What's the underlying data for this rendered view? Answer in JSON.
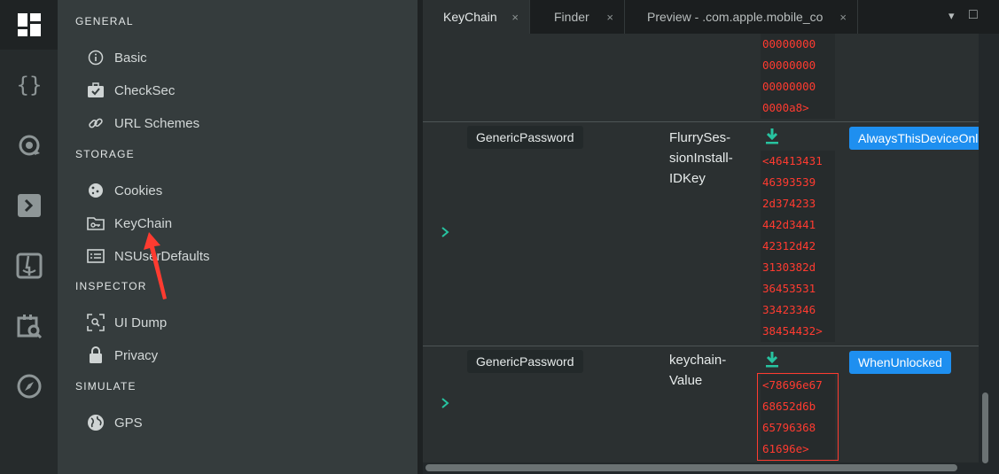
{
  "sidebar": {
    "sections": [
      {
        "title": "GENERAL",
        "items": [
          {
            "label": "Basic",
            "icon": "info-icon"
          },
          {
            "label": "CheckSec",
            "icon": "briefcase-check-icon"
          },
          {
            "label": "URL Schemes",
            "icon": "link-icon"
          }
        ]
      },
      {
        "title": "STORAGE",
        "items": [
          {
            "label": "Cookies",
            "icon": "cookie-icon"
          },
          {
            "label": "KeyChain",
            "icon": "folder-key-icon"
          },
          {
            "label": "NSUserDefaults",
            "icon": "list-box-icon"
          }
        ]
      },
      {
        "title": "INSPECTOR",
        "items": [
          {
            "label": "UI Dump",
            "icon": "scan-icon"
          },
          {
            "label": "Privacy",
            "icon": "lock-icon"
          }
        ]
      },
      {
        "title": "SIMULATE",
        "items": [
          {
            "label": "GPS",
            "icon": "globe-icon"
          }
        ]
      }
    ]
  },
  "tabs": [
    {
      "label": "KeyChain",
      "close": "×"
    },
    {
      "label": "Finder",
      "close": "×"
    },
    {
      "label": "Preview - .com.apple.mobile_co",
      "close": "×"
    }
  ],
  "window_controls": {
    "menu": "▾",
    "maximize": "□"
  },
  "rows": [
    {
      "hex": [
        "00000000",
        "00000000",
        "00000000",
        "0000a8>"
      ]
    },
    {
      "class": "GenericPassword",
      "key": [
        "FlurrySes-",
        "sionInstall-",
        "IDKey"
      ],
      "hex": [
        "<46413431",
        "46393539",
        "2d374233",
        "442d3441",
        "42312d42",
        "3130382d",
        "36453531",
        "33423346",
        "38454432>"
      ],
      "access": "AlwaysThisDeviceOnl"
    },
    {
      "class": "GenericPassword",
      "key": [
        "keychain-",
        "Value"
      ],
      "hex": [
        "<78696e67",
        "68652d6b",
        "65796368",
        "61696e>"
      ],
      "access": "WhenUnlocked"
    }
  ],
  "colors": {
    "accent": "#1e8ff0",
    "hex_text": "#ff3b30",
    "expand": "#27c3a0",
    "annotation": "#ff3b30"
  }
}
